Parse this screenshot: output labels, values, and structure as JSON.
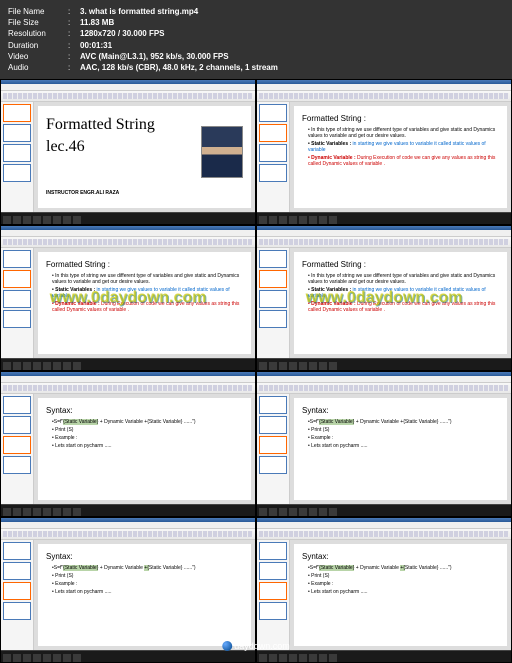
{
  "info": {
    "filename_label": "File Name",
    "filename": "3. what is formatted string.mp4",
    "filesize_label": "File Size",
    "filesize": "11.83 MB",
    "resolution_label": "Resolution",
    "resolution": "1280x720 / 30.000 FPS",
    "duration_label": "Duration",
    "duration": "00:01:31",
    "video_label": "Video",
    "video": "AVC (Main@L3.1), 952 kb/s, 30.000 FPS",
    "audio_label": "Audio",
    "audio": "AAC, 128 kb/s (CBR), 48.0 kHz, 2 channels, 1 stream"
  },
  "slide_title": {
    "line1": "Formatted String",
    "line2": "lec.46",
    "instructor": "INSTRUCTOR ENGR.ALI RAZA"
  },
  "slide_content": {
    "heading": "Formatted  String :",
    "b1": "• In this type of string we use different type of variables and give static and Dynamics values to variable and get our desire values.",
    "static_label": "• Static Variables :",
    "static_text": " in starting we give values to variable it called static values of variable",
    "dynamic_label": "• Dynamic Variable :",
    "dynamic_text": " During Execution of code  we can give any values as string this called Dynamic values of variable ."
  },
  "slide_syntax": {
    "heading": "Syntax:",
    "line1_a": "•S=f\" {Static Variable} + Dynamic Variable  +{Static Variable} ......\")",
    "line1_b": "•S=f\"{Static Variable} + Dynamic Variable  +{Static Variable} ......\")",
    "line2": "• Print (S)",
    "line3": "• Example :",
    "line4": "• Lets start on pycharm ....."
  },
  "watermark": "www.0daydown.com",
  "footer": "daydown.com"
}
